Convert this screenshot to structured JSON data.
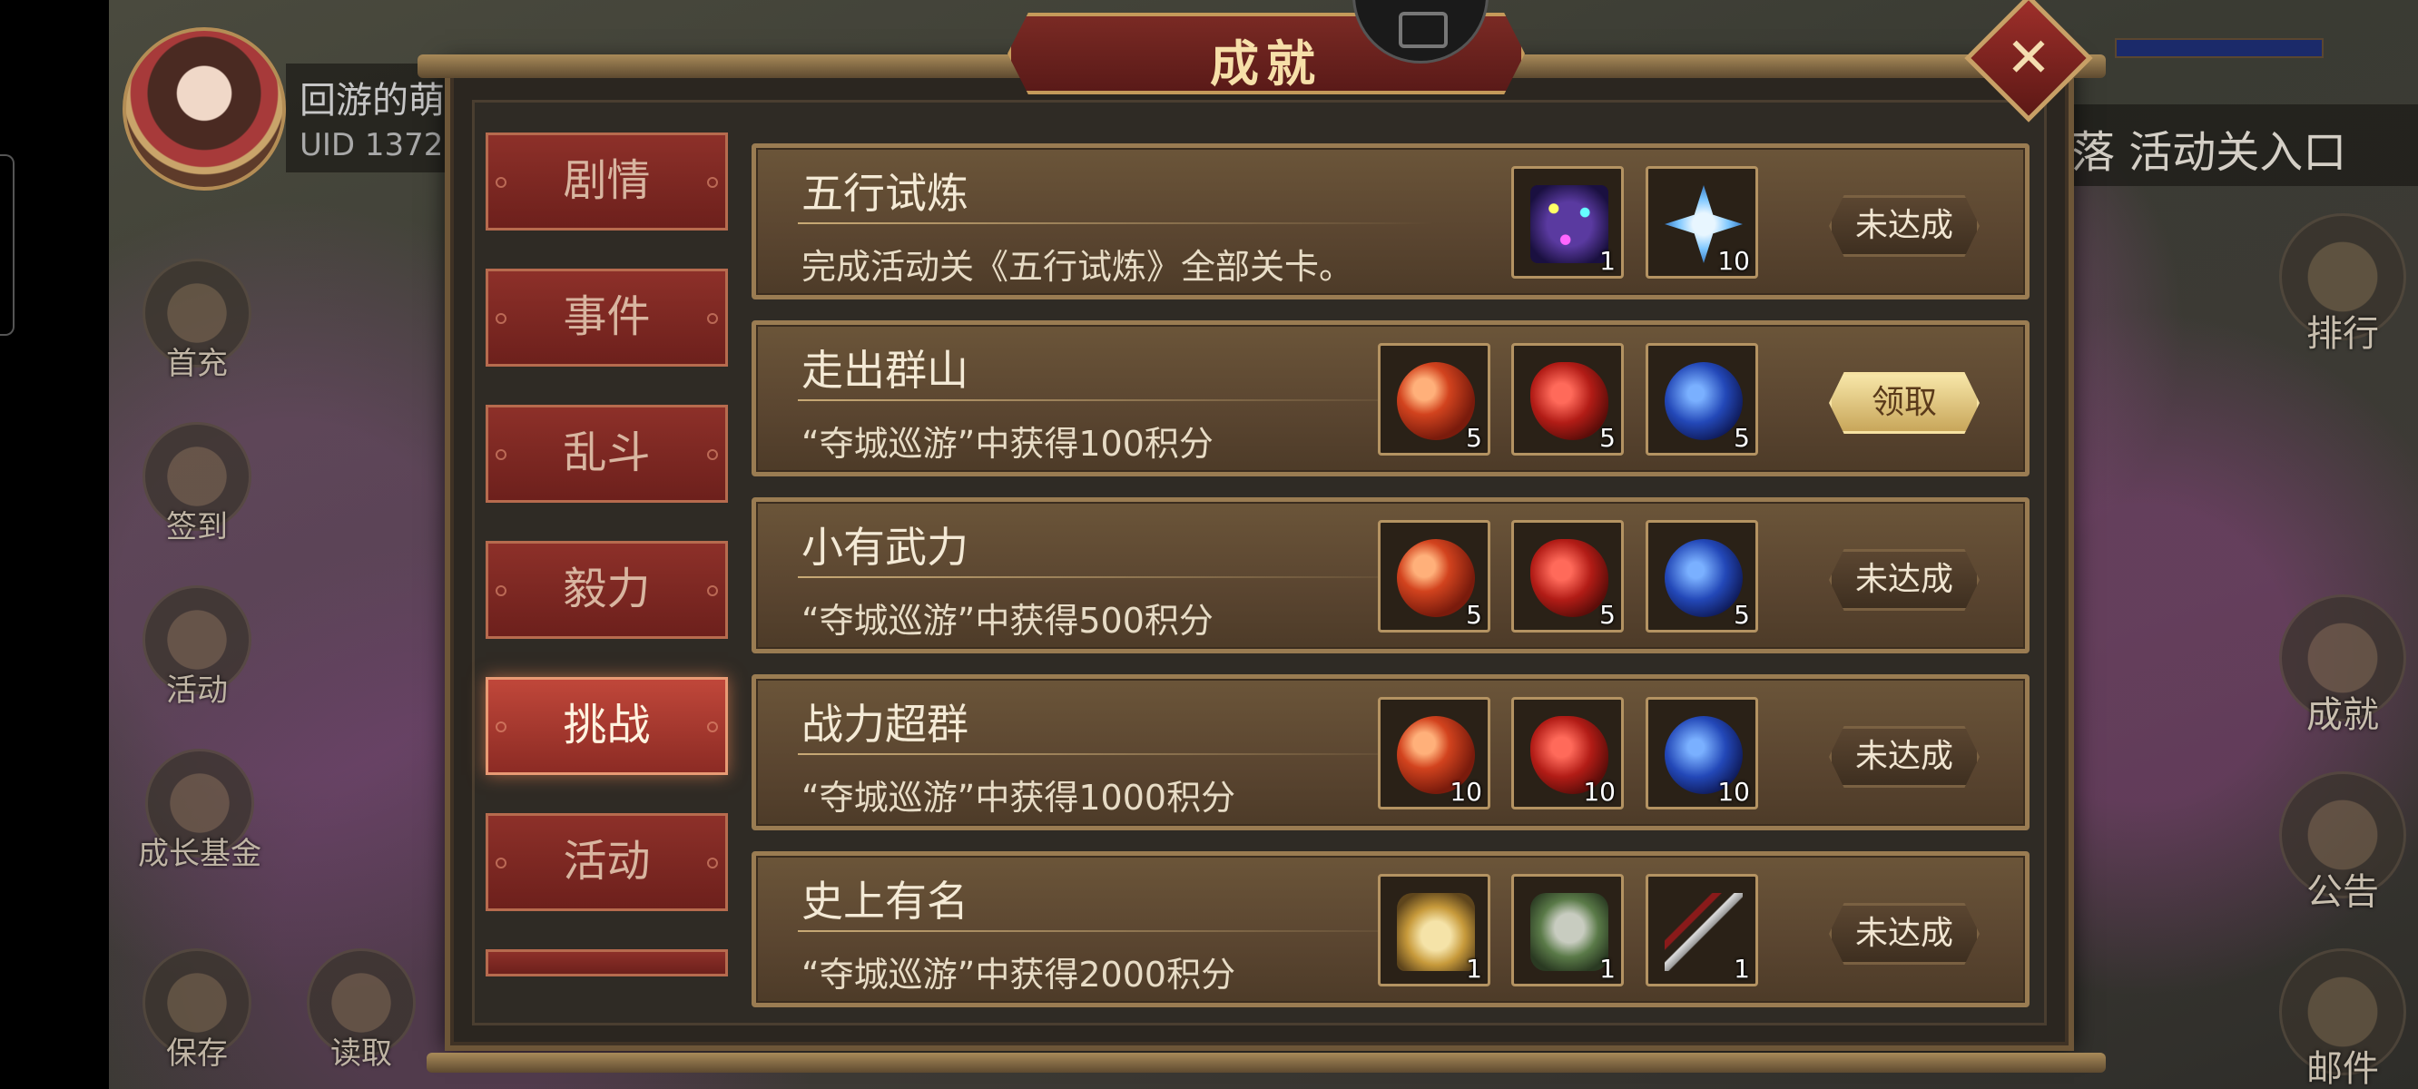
{
  "player": {
    "name": "回游的萌",
    "uid": "UID  1372"
  },
  "event_banner": "落 活动关入口",
  "left_menu": [
    {
      "label": "首充"
    },
    {
      "label": "签到"
    },
    {
      "label": "活动"
    },
    {
      "label": "成长基金"
    },
    {
      "label": "保存"
    },
    {
      "label": "读取"
    }
  ],
  "right_menu": [
    {
      "label": "排行"
    },
    {
      "label": "成就"
    },
    {
      "label": "公告"
    },
    {
      "label": "邮件"
    }
  ],
  "panel": {
    "title": "成就",
    "close_icon": "close-icon"
  },
  "tabs": [
    {
      "label": "剧情",
      "active": false
    },
    {
      "label": "事件",
      "active": false
    },
    {
      "label": "乱斗",
      "active": false
    },
    {
      "label": "毅力",
      "active": false
    },
    {
      "label": "挑战",
      "active": true
    },
    {
      "label": "活动",
      "active": false
    }
  ],
  "achievements": [
    {
      "title": "五行试炼",
      "desc": "完成活动关《五行试炼》全部关卡。",
      "status": "未达成",
      "rewards": [
        {
          "icon": "star-orbs-icon",
          "qty": "1"
        },
        {
          "icon": "crystal-icon",
          "qty": "10"
        }
      ]
    },
    {
      "title": "走出群山",
      "desc": "“夺城巡游”中获得100积分",
      "status": "领取",
      "rewards": [
        {
          "icon": "orange-fruit-icon",
          "qty": "5"
        },
        {
          "icon": "red-fruit-icon",
          "qty": "5"
        },
        {
          "icon": "blue-fruit-icon",
          "qty": "5"
        }
      ]
    },
    {
      "title": "小有武力",
      "desc": "“夺城巡游”中获得500积分",
      "status": "未达成",
      "rewards": [
        {
          "icon": "orange-fruit-icon",
          "qty": "5"
        },
        {
          "icon": "red-fruit-icon",
          "qty": "5"
        },
        {
          "icon": "blue-fruit-icon",
          "qty": "5"
        }
      ]
    },
    {
      "title": "战力超群",
      "desc": "“夺城巡游”中获得1000积分",
      "status": "未达成",
      "rewards": [
        {
          "icon": "orange-fruit-icon",
          "qty": "10"
        },
        {
          "icon": "red-fruit-icon",
          "qty": "10"
        },
        {
          "icon": "blue-fruit-icon",
          "qty": "10"
        }
      ]
    },
    {
      "title": "史上有名",
      "desc": "“夺城巡游”中获得2000积分",
      "status": "未达成",
      "rewards": [
        {
          "icon": "golden-helmet-icon",
          "qty": "1"
        },
        {
          "icon": "armor-icon",
          "qty": "1"
        },
        {
          "icon": "dagger-icon",
          "qty": "1"
        }
      ]
    }
  ]
}
